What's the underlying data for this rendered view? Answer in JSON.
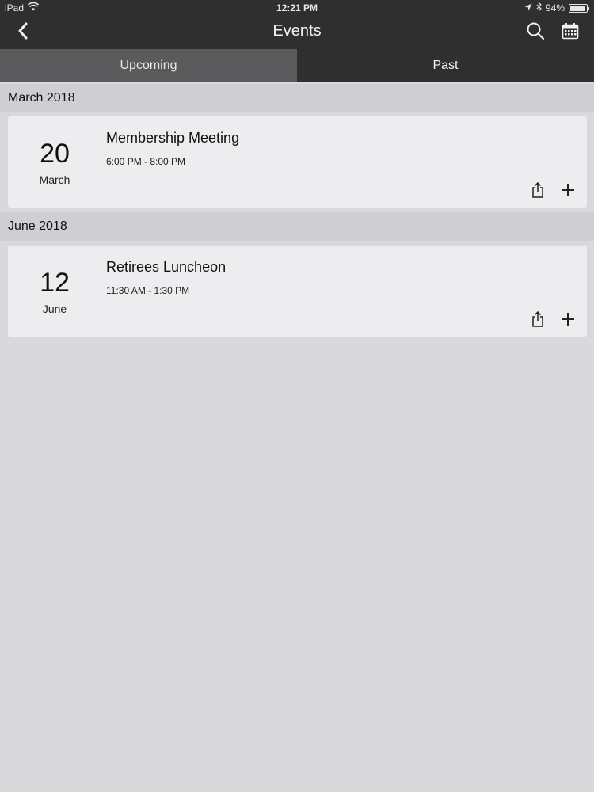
{
  "status_bar": {
    "device": "iPad",
    "time": "12:21 PM",
    "battery": "94%",
    "battery_level": 0.94
  },
  "nav": {
    "title": "Events",
    "icons": [
      "chevron-left-icon",
      "search-icon",
      "calendar-icon"
    ]
  },
  "tabs": [
    {
      "label": "Upcoming",
      "active": true
    },
    {
      "label": "Past",
      "active": false
    }
  ],
  "sections": [
    {
      "header": "March 2018",
      "events": [
        {
          "day": "20",
          "month": "March",
          "title": "Membership Meeting",
          "time": "6:00 PM - 8:00 PM"
        }
      ]
    },
    {
      "header": "June 2018",
      "events": [
        {
          "day": "12",
          "month": "June",
          "title": "Retirees Luncheon",
          "time": "11:30 AM - 1:30 PM"
        }
      ]
    }
  ],
  "colors": {
    "bar": "#2f2f2f",
    "active_tab": "#5a5a5c",
    "background": "#d9d8db",
    "card": "#edecef",
    "section_header": "#cfced2"
  }
}
